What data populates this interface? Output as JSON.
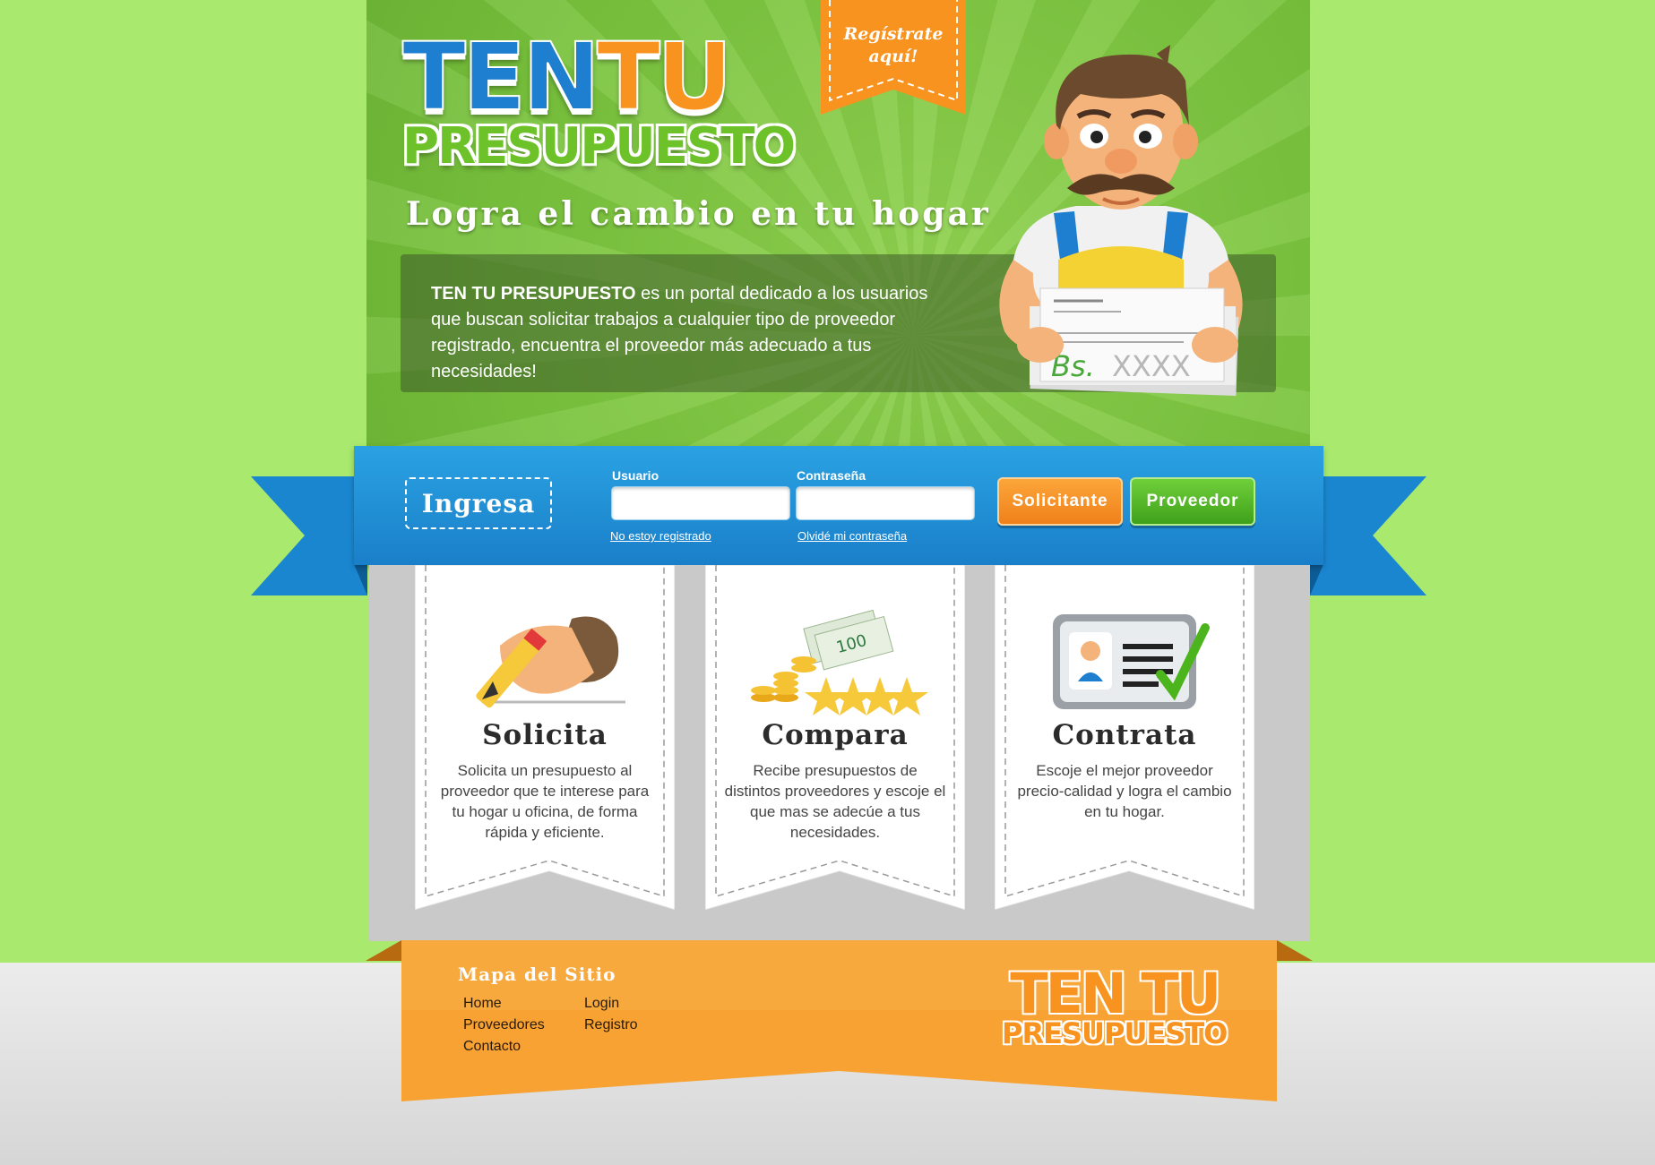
{
  "brand": {
    "logo_line1_a": "TEN",
    "logo_line1_b": "TU",
    "logo_line2": "PRESUPUESTO",
    "tagline": "Logra el cambio en tu hogar",
    "register_cta": "Regístrate aquí!",
    "colors": {
      "green": "#78c23c",
      "blue": "#1e7fd0",
      "orange": "#f7931e",
      "light_green": "#a9e96e"
    }
  },
  "intro": {
    "brand_bold": "TEN TU PRESUPUESTO",
    "text": " es un portal dedicado a los usuarios que buscan solicitar trabajos a cualquier tipo de proveedor registrado, encuentra el proveedor más adecuado a tus necesidades!"
  },
  "mascot": {
    "paper_currency": "Bs.",
    "paper_amount": "XXXX"
  },
  "login": {
    "title": "Ingresa",
    "user_label": "Usuario",
    "user_value": "",
    "password_label": "Contraseña",
    "password_value": "",
    "not_registered_link": "No estoy registrado",
    "forgot_link": "Olvidé mi contraseña",
    "btn_solicitante": "Solicitante",
    "btn_proveedor": "Proveedor"
  },
  "features": [
    {
      "title": "Solicita",
      "icon": "pencil-hand-icon",
      "text": "Solicita un presupuesto al proveedor que te interese para tu hogar u oficina, de forma rápida y eficiente."
    },
    {
      "title": "Compara",
      "icon": "money-stars-icon",
      "text": "Recibe presupuestos de distintos proveedores y escoje el que mas se adecúe a tus necesidades."
    },
    {
      "title": "Contrata",
      "icon": "id-card-check-icon",
      "text": "Escoje el mejor proveedor precio-calidad y logra el cambio en tu hogar."
    }
  ],
  "footer": {
    "sitemap_title": "Mapa del Sitio",
    "links_col1": [
      "Home",
      "Proveedores",
      "Contacto"
    ],
    "links_col2": [
      "Login",
      "Registro"
    ],
    "logo_line1": "TEN TU",
    "logo_line2": "PRESUPUESTO"
  }
}
